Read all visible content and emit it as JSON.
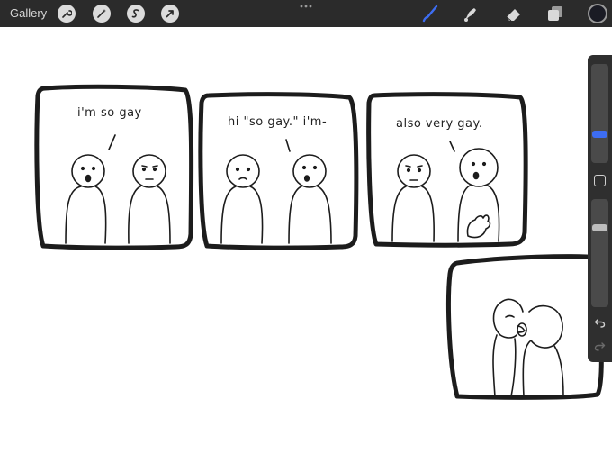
{
  "toolbar": {
    "gallery_label": "Gallery",
    "left_tools": [
      "wrench-icon",
      "magic-wand-icon",
      "selection-icon",
      "transform-arrow-icon"
    ],
    "right_tools": [
      "brush-icon",
      "smudge-icon",
      "eraser-icon",
      "layers-icon"
    ],
    "active_tool": "brush-icon",
    "active_color": "#1a1b24",
    "accent": "#3d6df2"
  },
  "comic": {
    "panels": [
      {
        "speech": "i'm so gay"
      },
      {
        "speech": "hi \"so gay.\" i'm-"
      },
      {
        "speech": "also very gay."
      },
      {
        "speech": ""
      }
    ]
  },
  "sidebar": {
    "brush_size_level": 0.27,
    "opacity_level": 0.25,
    "icons": [
      "modify-square-icon",
      "undo-icon",
      "redo-icon"
    ]
  }
}
